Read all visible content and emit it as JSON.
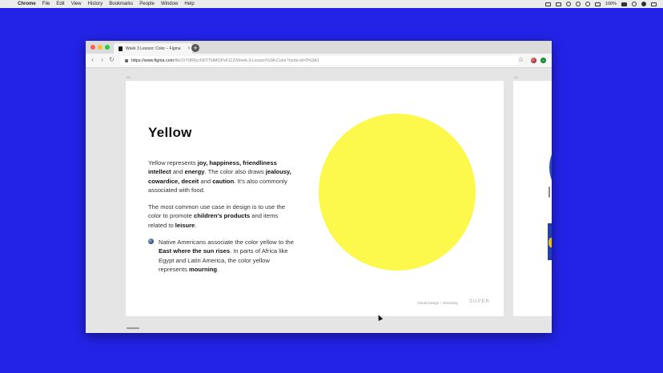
{
  "menubar": {
    "app": "Chrome",
    "items": [
      "File",
      "Edit",
      "View",
      "History",
      "Bookmarks",
      "People",
      "Window",
      "Help"
    ],
    "battery": "100%",
    "status_icons": [
      "display-icon",
      "camera-icon",
      "clock-icon",
      "bluetooth-icon",
      "wifi-icon",
      "volume-icon",
      "battery-icon",
      "search-icon",
      "user-icon",
      "list-icon"
    ]
  },
  "browser": {
    "tab_title": "Week 3 Lesson: Color – Figma",
    "tab_close": "×",
    "new_tab": "+",
    "url_host": "https://www.figma.com",
    "url_path": "/file/2rY9R6ccN0TTHMOPsF11Z/Week-3-Lesson%3A-Color?node-id=0%3A1",
    "traffic_light_colors": [
      "#fc5f57",
      "#fdbc2e",
      "#28c840"
    ]
  },
  "canvas": {
    "frame_label_left": "325",
    "frame_label_right": "326"
  },
  "slide": {
    "heading": "Yellow",
    "p1": {
      "t1": "Yellow represents ",
      "b1": "joy, happiness, friendliness intellect",
      "t2": " and ",
      "b2": "energy",
      "t3": ". The color also draws ",
      "b3": "jealousy, cowardice, deceit",
      "t4": " and ",
      "b4": "caution",
      "t5": ". It's also commonly associated with food."
    },
    "p2": {
      "t1": "The most common use case in design is to use the color to promote ",
      "b1": "children's products",
      "t2": " and items related to ",
      "b2": "leisure",
      "t3": "."
    },
    "p3": {
      "t1": "Native Americans associate the color yellow to the ",
      "b1": "East where the sun rises",
      "t2": ". In parts of Africa like Egypt and Latin America, the color yellow represents ",
      "b2": "mourning",
      "t3": "."
    },
    "footer": "Visual Design + Branding",
    "brand": "SUPER",
    "circle_color": "#fdf84c"
  },
  "colors": {
    "desktop": "#2323e8",
    "slide2_accent": "#2240a8",
    "slide2_dot": "#f2c300"
  }
}
